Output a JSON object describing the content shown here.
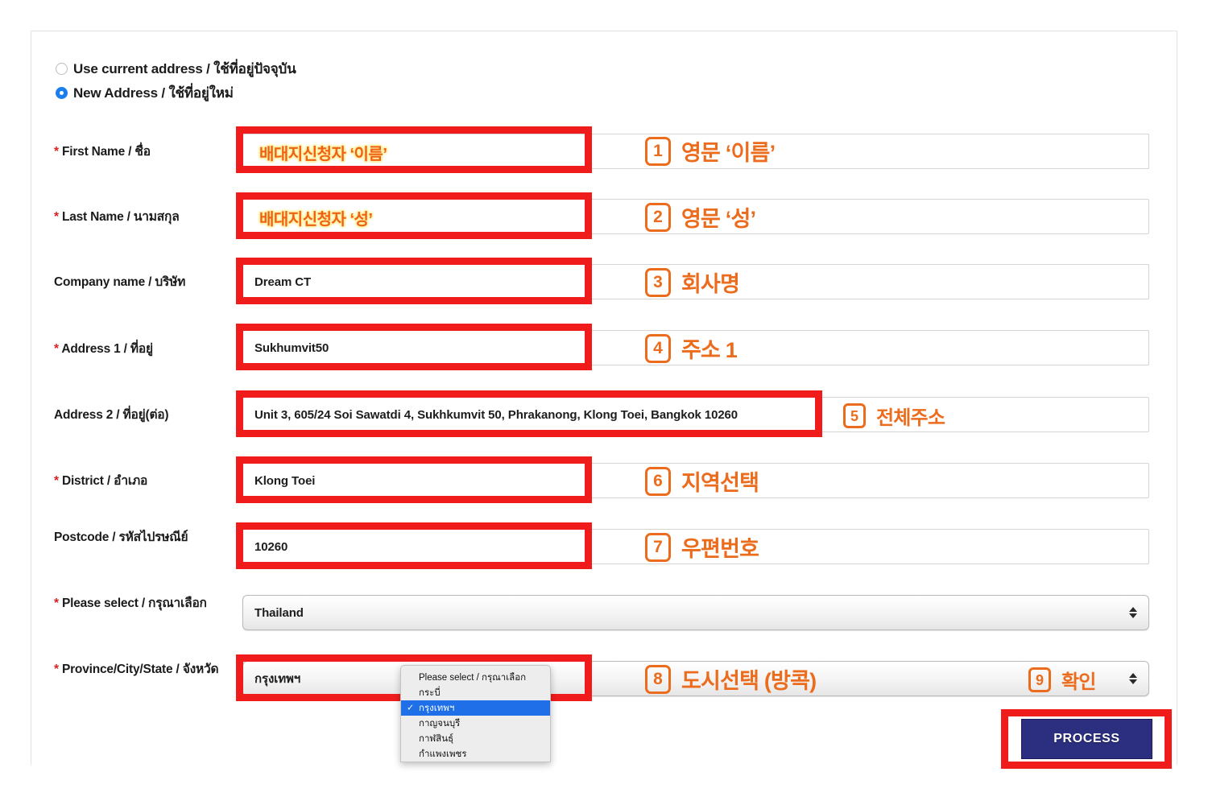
{
  "address_choice": {
    "options": [
      {
        "label": "Use current address / ใช้ที่อยู่ปัจจุบัน",
        "selected": false
      },
      {
        "label": "New Address / ใช้ที่อยู่ใหม่",
        "selected": true
      }
    ]
  },
  "form": {
    "fields": [
      {
        "label": "First Name / ชื่อ",
        "required": true,
        "value": "",
        "overlay": "배대지신청자 ‘이름’"
      },
      {
        "label": "Last Name / นามสกุล",
        "required": true,
        "value": "",
        "overlay": "배대지신청자 ‘성’"
      },
      {
        "label": "Company name / บริษัท",
        "required": false,
        "value": "Dream CT",
        "overlay": ""
      },
      {
        "label": "Address 1 / ที่อยู่",
        "required": true,
        "value": "Sukhumvit50",
        "overlay": ""
      },
      {
        "label": "Address 2 / ที่อยู่(ต่อ)",
        "required": false,
        "value": "Unit 3, 605/24 Soi Sawatdi 4, Sukhkumvit 50, Phrakanong, Klong Toei, Bangkok 10260",
        "overlay": ""
      },
      {
        "label": "District / อำเภอ",
        "required": true,
        "value": "Klong Toei",
        "overlay": ""
      },
      {
        "label": "Postcode / รหัสไปรษณีย์",
        "required": false,
        "value": "10260",
        "overlay": ""
      },
      {
        "label": "Please select / กรุณาเลือก",
        "required": true,
        "value": "Thailand",
        "overlay": ""
      },
      {
        "label": "Province/City/State / จังหวัด",
        "required": true,
        "value": "กรุงเทพฯ",
        "overlay": ""
      }
    ]
  },
  "dropdown": {
    "options": [
      {
        "label": "Please select / กรุณาเลือก",
        "selected": false
      },
      {
        "label": "กระบี่",
        "selected": false
      },
      {
        "label": "กรุงเทพฯ",
        "selected": true
      },
      {
        "label": "กาญจนบุรี",
        "selected": false
      },
      {
        "label": "กาฬสินธุ์",
        "selected": false
      },
      {
        "label": "กำแพงเพชร",
        "selected": false
      }
    ],
    "check_glyph": "✓"
  },
  "annotations": [
    {
      "num": "1",
      "text": "영문 ‘이름’"
    },
    {
      "num": "2",
      "text": "영문 ‘성’"
    },
    {
      "num": "3",
      "text": "회사명"
    },
    {
      "num": "4",
      "text": "주소 1"
    },
    {
      "num": "5",
      "text": "전체주소"
    },
    {
      "num": "6",
      "text": "지역선택"
    },
    {
      "num": "7",
      "text": "우편번호"
    },
    {
      "num": "8",
      "text": "도시선택 (방콕)"
    },
    {
      "num": "9",
      "text": "확인"
    }
  ],
  "submit": {
    "label": "PROCESS"
  },
  "colors": {
    "highlight_red": "#f01c1c",
    "annotation_orange": "#ec6c1d",
    "overlay_halo": "#fdf0a8",
    "radio_blue": "#1a7ef0",
    "required_red": "#e02020",
    "button_navy": "#2c2f7f",
    "dropdown_selected": "#1f6fe8"
  }
}
